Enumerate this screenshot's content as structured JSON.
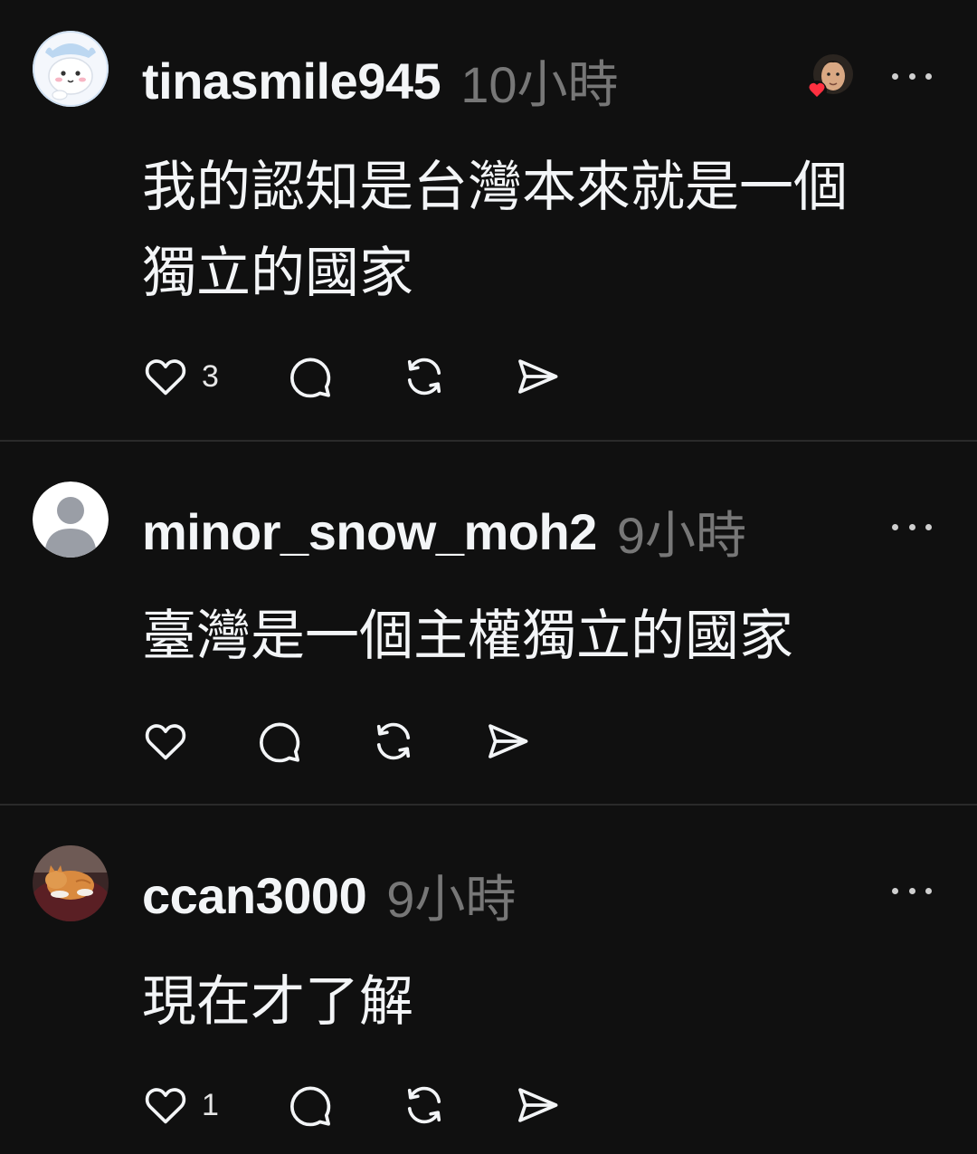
{
  "comments": [
    {
      "username": "tinasmile945",
      "time": "10小時",
      "text_lines": [
        "我的認知是台灣本來就是一個",
        "獨立的國家"
      ],
      "likes": "3",
      "avatar": "cartoon-character-avatar",
      "liked_by_author": true
    },
    {
      "username": "minor_snow_moh2",
      "time": "9小時",
      "text_lines": [
        "臺灣是一個主權獨立的國家"
      ],
      "likes": "",
      "avatar": "default-person-avatar",
      "liked_by_author": false
    },
    {
      "username": "ccan3000",
      "time": "9小時",
      "text_lines": [
        "現在才了解"
      ],
      "likes": "1",
      "avatar": "cat-photo-avatar",
      "liked_by_author": false
    }
  ],
  "icons": {
    "like": "heart-icon",
    "reply": "speech-bubble-icon",
    "repost": "repost-icon",
    "share": "paper-plane-icon",
    "more": "more-dots-icon"
  },
  "colors": {
    "background": "#101010",
    "text": "#f3f5f7",
    "muted": "#777777",
    "heart_badge": "#ff3040"
  }
}
